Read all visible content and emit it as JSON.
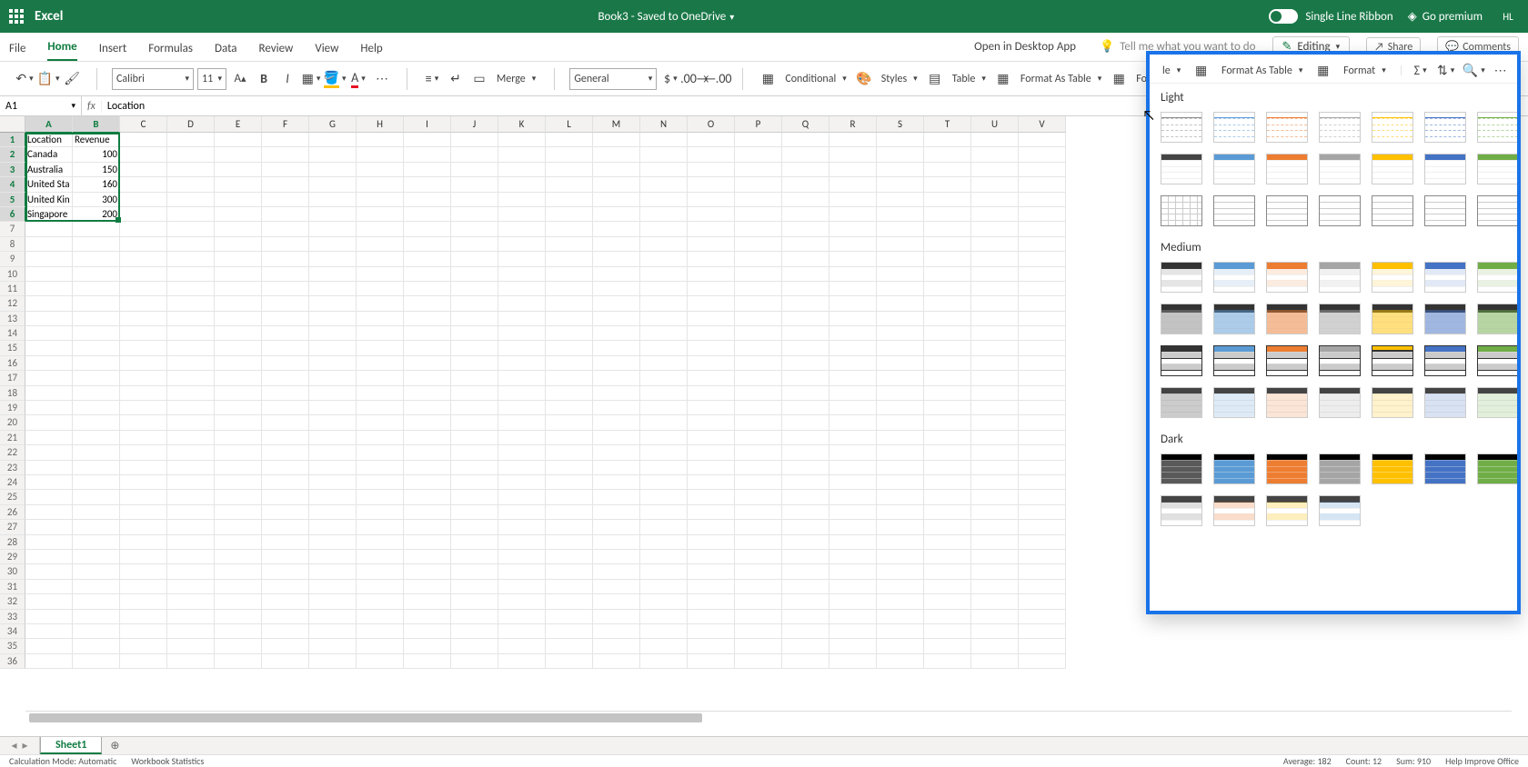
{
  "titleBar": {
    "appName": "Excel",
    "docTitle": "Book3 - Saved to OneDrive",
    "singleLineRibbon": "Single Line Ribbon",
    "goPremium": "Go premium",
    "userInitials": "HL"
  },
  "tabs": {
    "file": "File",
    "home": "Home",
    "insert": "Insert",
    "formulas": "Formulas",
    "data": "Data",
    "review": "Review",
    "view": "View",
    "help": "Help",
    "openDesktop": "Open in Desktop App",
    "tellMe": "Tell me what you want to do",
    "editing": "Editing",
    "share": "Share",
    "comments": "Comments"
  },
  "ribbon": {
    "fontName": "Calibri",
    "fontSize": "11",
    "merge": "Merge",
    "numberFormat": "General",
    "conditional": "Conditional",
    "styles": "Styles",
    "table": "Table",
    "formatAsTable": "Format As Table",
    "format": "Format"
  },
  "nameBox": "A1",
  "formula": "Location",
  "columns": [
    "A",
    "B",
    "C",
    "D",
    "E",
    "F",
    "G",
    "H",
    "I",
    "J",
    "K",
    "L",
    "M",
    "N",
    "O",
    "P",
    "Q",
    "R",
    "S",
    "T",
    "U",
    "V"
  ],
  "cells": {
    "headers": [
      "Location",
      "Revenue"
    ],
    "rows": [
      {
        "loc": "Canada",
        "rev": "100"
      },
      {
        "loc": "Australia",
        "rev": "150"
      },
      {
        "loc": "United Sta",
        "rev": "160"
      },
      {
        "loc": "United Kin",
        "rev": "300"
      },
      {
        "loc": "Singapore",
        "rev": "200"
      }
    ]
  },
  "sheetTab": "Sheet1",
  "status": {
    "calcMode": "Calculation Mode: Automatic",
    "wbStats": "Workbook Statistics",
    "average": "Average: 182",
    "count": "Count: 12",
    "sum": "Sum: 910",
    "help": "Help Improve Office"
  },
  "fat": {
    "light": "Light",
    "medium": "Medium",
    "dark": "Dark"
  }
}
